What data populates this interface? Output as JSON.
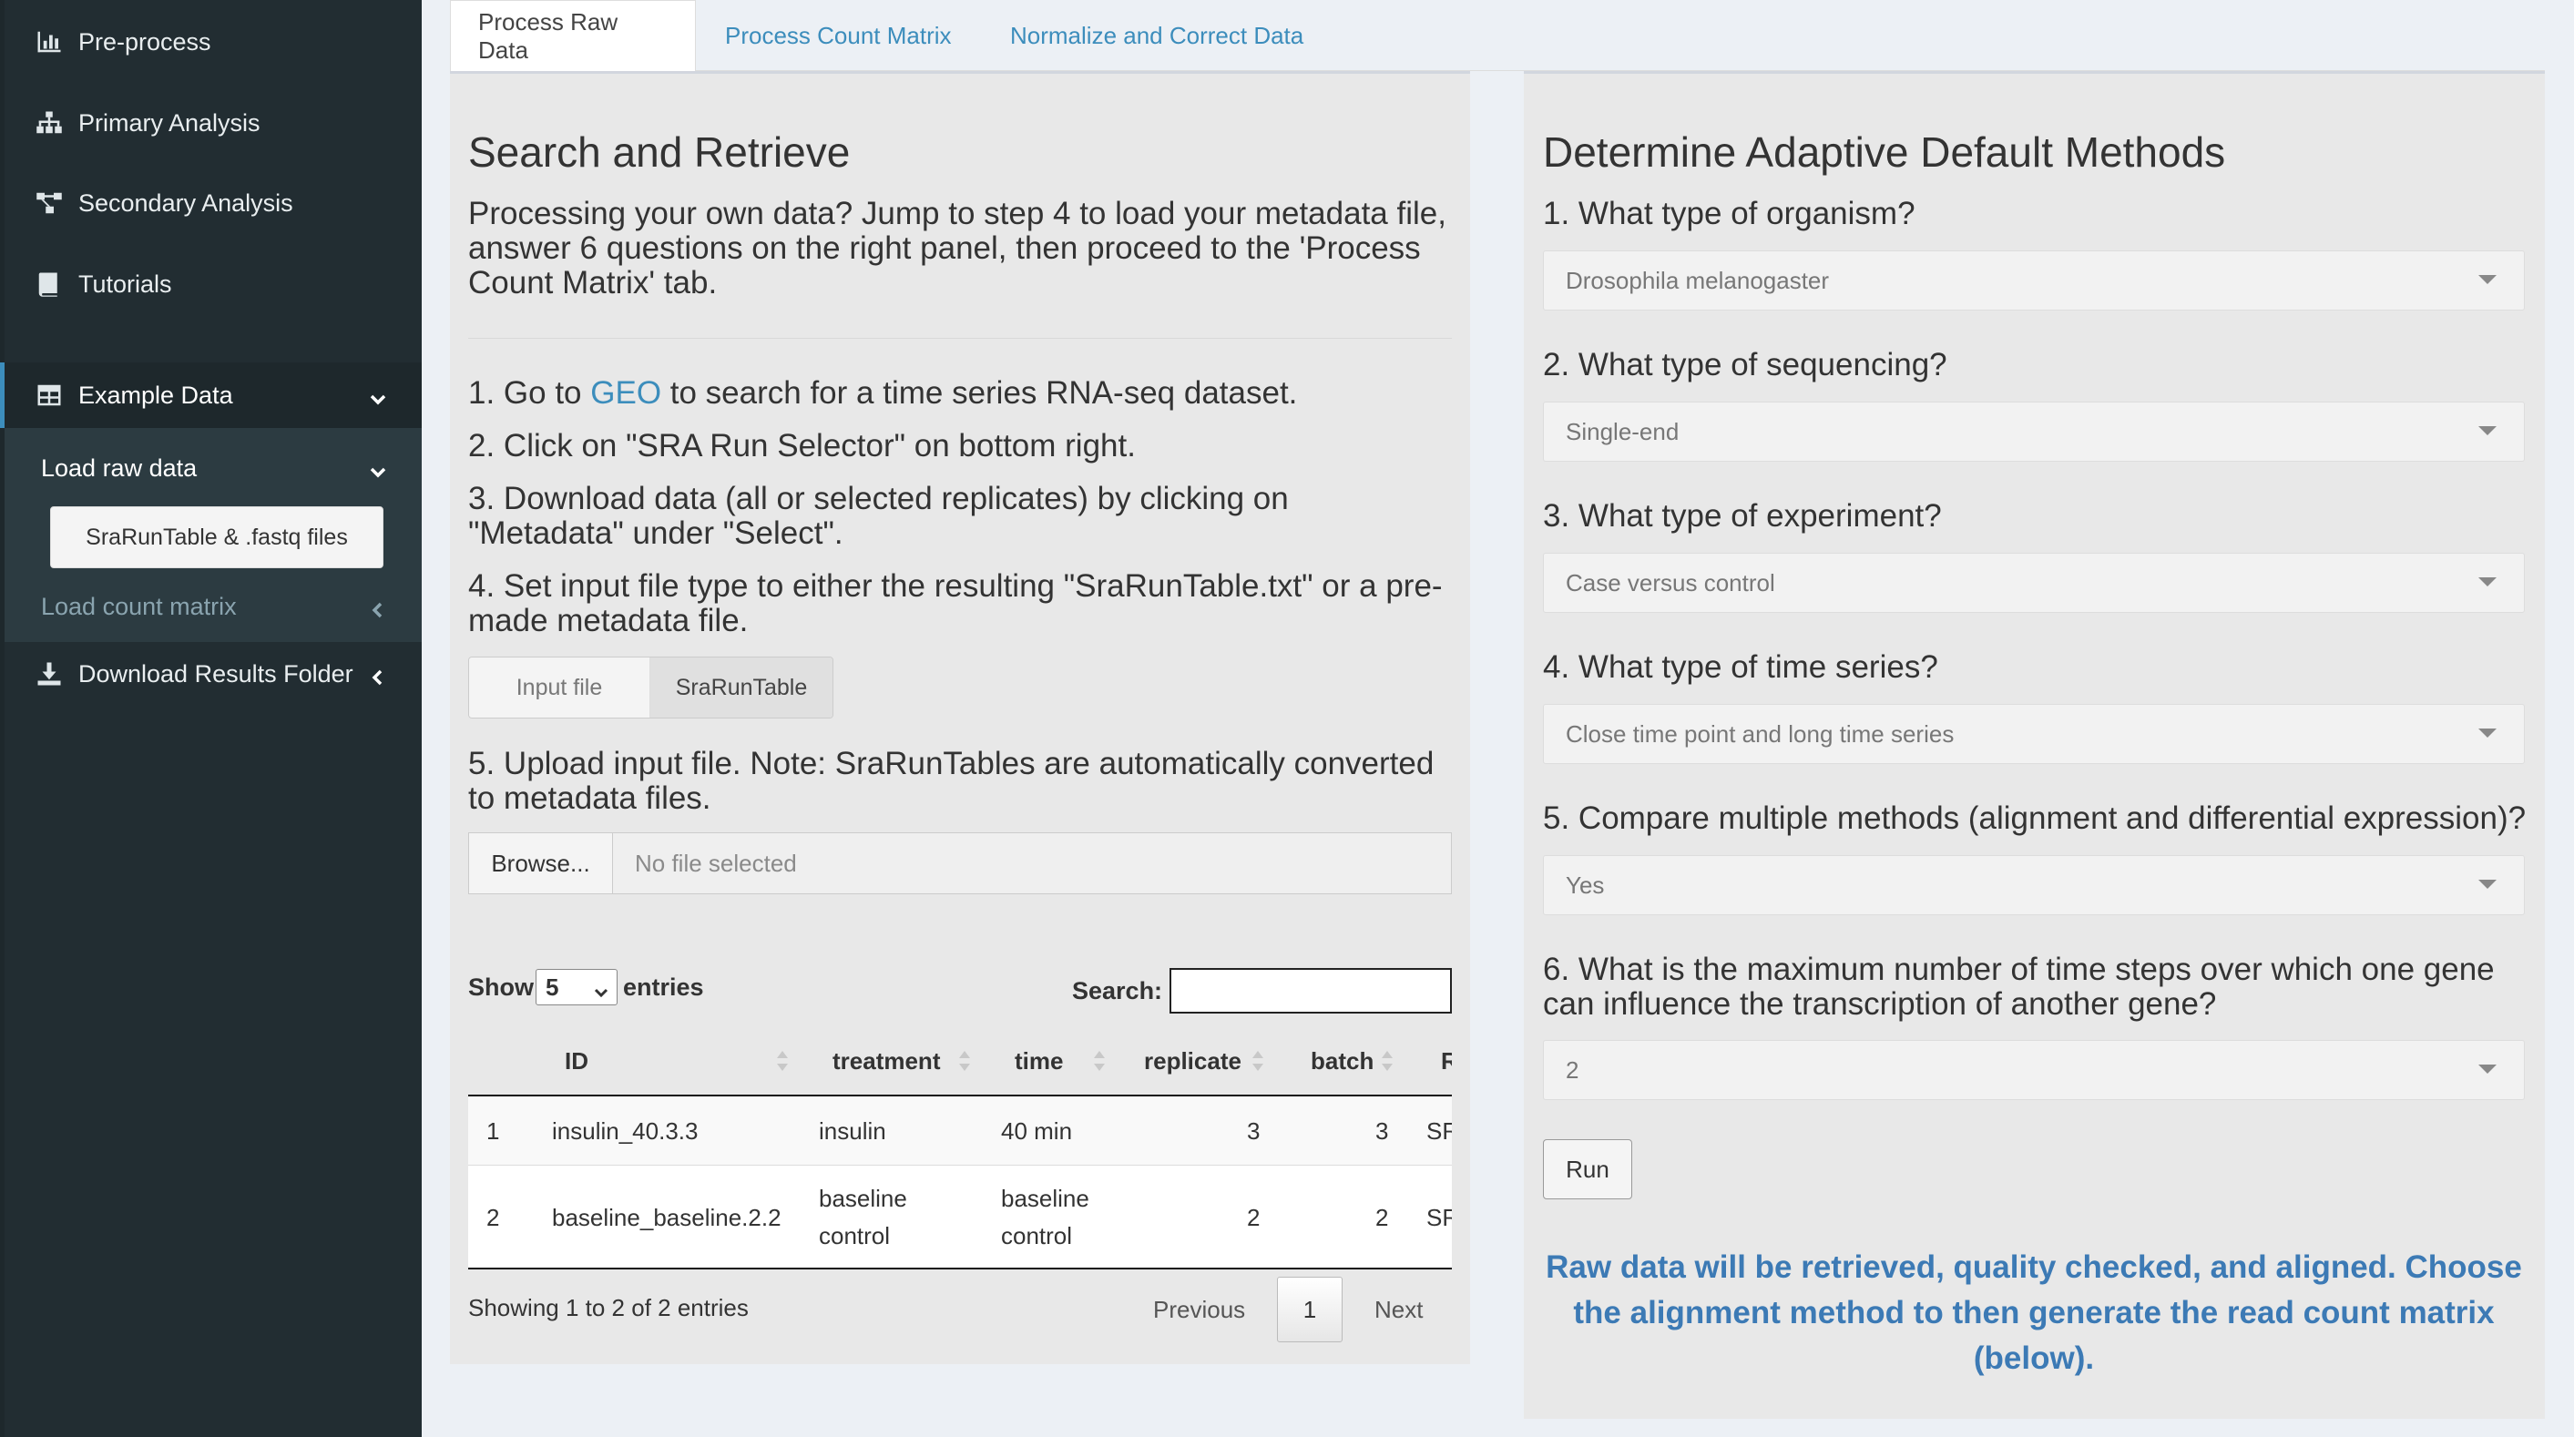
{
  "sidebar": {
    "items": [
      {
        "label": "Pre-process",
        "icon": "bar-chart-icon"
      },
      {
        "label": "Primary Analysis",
        "icon": "sitemap-icon"
      },
      {
        "label": "Secondary Analysis",
        "icon": "project-diagram-icon"
      },
      {
        "label": "Tutorials",
        "icon": "book-icon"
      }
    ],
    "example_data": {
      "label": "Example Data",
      "icon": "table-icon"
    },
    "load_raw": "Load raw data",
    "sra_button": "SraRunTable & .fastq files",
    "load_count": "Load count matrix",
    "download": {
      "label": "Download Results Folder",
      "icon": "download-icon"
    }
  },
  "tabs": [
    "Process Raw Data",
    "Process Count Matrix",
    "Normalize and Correct Data"
  ],
  "left": {
    "title": "Search and Retrieve",
    "intro": "Processing your own data? Jump to step 4 to load your metadata file, answer 6 questions on the right panel, then proceed to the 'Process Count Matrix' tab.",
    "step1_pre": "1. Go to ",
    "step1_link": "GEO",
    "step1_post": " to search for a time series RNA-seq dataset.",
    "step2": "2. Click on \"SRA Run Selector\" on bottom right.",
    "step3": "3. Download data (all or selected replicates) by clicking on \"Metadata\" under \"Select\".",
    "step4": "4. Set input file type to either the resulting \"SraRunTable.txt\" or a pre-made metadata file.",
    "toggle": {
      "option_a": "Input file",
      "option_b": "SraRunTable"
    },
    "step5": "5. Upload input file. Note: SraRunTables are automatically converted to metadata files.",
    "browse": "Browse...",
    "no_file": "No file selected",
    "show": "Show",
    "entries_value": "5",
    "entries": "entries",
    "search_label": "Search:",
    "table": {
      "headers": [
        "ID",
        "treatment",
        "time",
        "replicate",
        "batch",
        "R"
      ],
      "rows": [
        {
          "n": "1",
          "id": "insulin_40.3.3",
          "treatment": "insulin",
          "time": "40 min",
          "replicate": "3",
          "batch": "3",
          "r": "SR"
        },
        {
          "n": "2",
          "id": "baseline_baseline.2.2",
          "treatment_1": "baseline",
          "treatment_2": "control",
          "time_1": "baseline",
          "time_2": "control",
          "replicate": "2",
          "batch": "2",
          "r": "SR"
        }
      ]
    },
    "showing": "Showing 1 to 2 of 2 entries",
    "previous": "Previous",
    "page": "1",
    "next": "Next"
  },
  "right": {
    "title": "Determine Adaptive Default Methods",
    "questions": [
      {
        "q": "1. What type of organism?",
        "value": "Drosophila melanogaster"
      },
      {
        "q": "2. What type of sequencing?",
        "value": "Single-end"
      },
      {
        "q": "3. What type of experiment?",
        "value": "Case versus control"
      },
      {
        "q": "4. What type of time series?",
        "value": "Close time point and long time series"
      },
      {
        "q": "5. Compare multiple methods (alignment and differential expression)?",
        "value": "Yes"
      },
      {
        "q": "6. What is the maximum number of time steps over which one gene can influence the transcription of another gene?",
        "value": "2"
      }
    ],
    "run": "Run",
    "note": "Raw data will be retrieved, quality checked, and aligned. Choose the alignment method to then generate the read count matrix (below)."
  }
}
